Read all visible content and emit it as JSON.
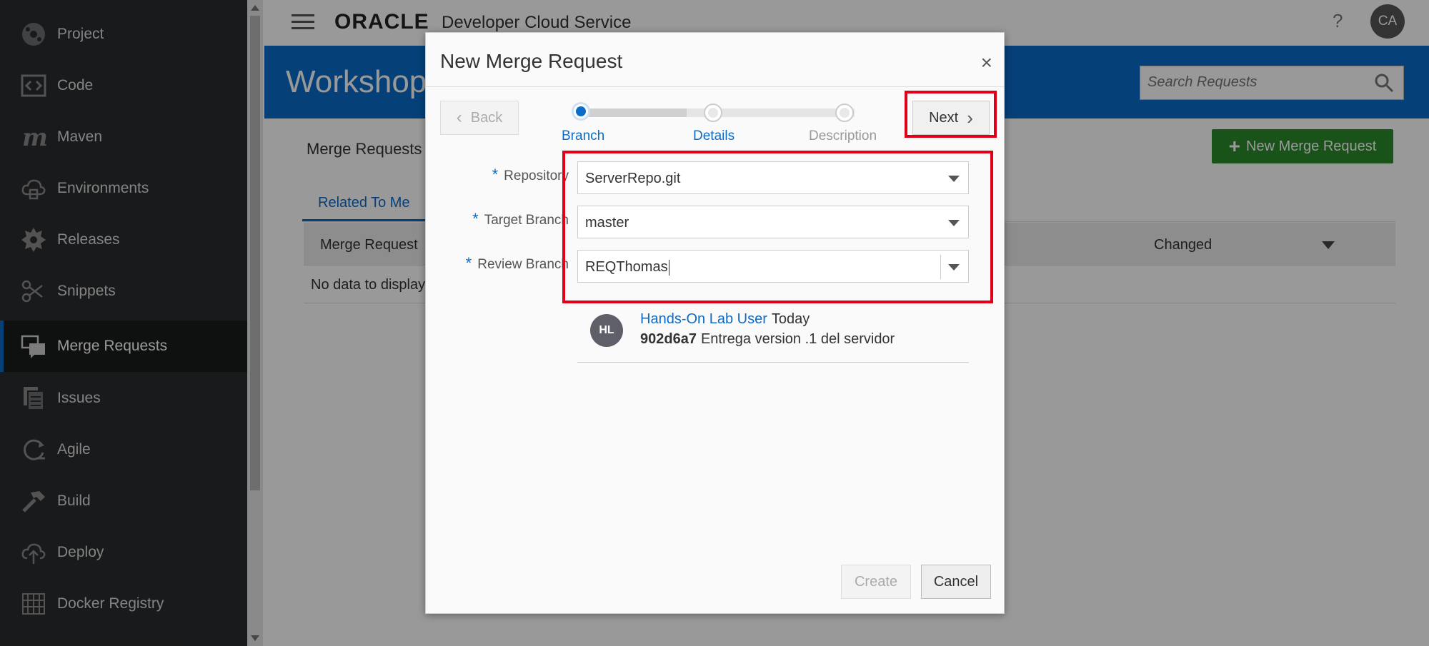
{
  "header": {
    "logo_text": "ORACLE",
    "product": "Developer Cloud Service",
    "help": "?",
    "avatar": "CA"
  },
  "sidebar": {
    "items": [
      {
        "label": "Project",
        "icon": "project-icon",
        "active": false
      },
      {
        "label": "Code",
        "icon": "code-icon",
        "active": false
      },
      {
        "label": "Maven",
        "icon": "maven-icon",
        "active": false
      },
      {
        "label": "Environments",
        "icon": "environments-icon",
        "active": false
      },
      {
        "label": "Releases",
        "icon": "releases-icon",
        "active": false
      },
      {
        "label": "Snippets",
        "icon": "snippets-icon",
        "active": false
      },
      {
        "label": "Merge Requests",
        "icon": "merge-requests-icon",
        "active": true
      },
      {
        "label": "Issues",
        "icon": "issues-icon",
        "active": false
      },
      {
        "label": "Agile",
        "icon": "agile-icon",
        "active": false
      },
      {
        "label": "Build",
        "icon": "build-icon",
        "active": false
      },
      {
        "label": "Deploy",
        "icon": "deploy-icon",
        "active": false
      },
      {
        "label": "Docker Registry",
        "icon": "docker-registry-icon",
        "active": false
      }
    ]
  },
  "banner": {
    "title": "Workshop",
    "search_placeholder": "Search Requests"
  },
  "main": {
    "heading": "Merge Requests",
    "new_button": "New Merge Request",
    "tab": "Related To Me",
    "table_headers": {
      "merge_request": "Merge Request",
      "changed": "Changed"
    },
    "empty_text": "No data to display"
  },
  "dialog": {
    "title": "New Merge Request",
    "close": "×",
    "back": "Back",
    "next": "Next",
    "steps": [
      "Branch",
      "Details",
      "Description"
    ],
    "current_step": "Branch",
    "fields": [
      {
        "label": "Repository",
        "value": "ServerRepo.git"
      },
      {
        "label": "Target Branch",
        "value": "master"
      },
      {
        "label": "Review Branch",
        "value": "REQThomas"
      }
    ],
    "commit": {
      "avatar": "HL",
      "author": "Hands-On Lab User",
      "when": "Today",
      "hash": "902d6a7",
      "message": "Entrega version .1 del servidor"
    },
    "create": "Create",
    "cancel": "Cancel"
  },
  "colors": {
    "accent": "#0b6cc9",
    "success": "#2b8a2b",
    "highlight": "#e0001a",
    "sidebar": "#2b2c2d"
  }
}
